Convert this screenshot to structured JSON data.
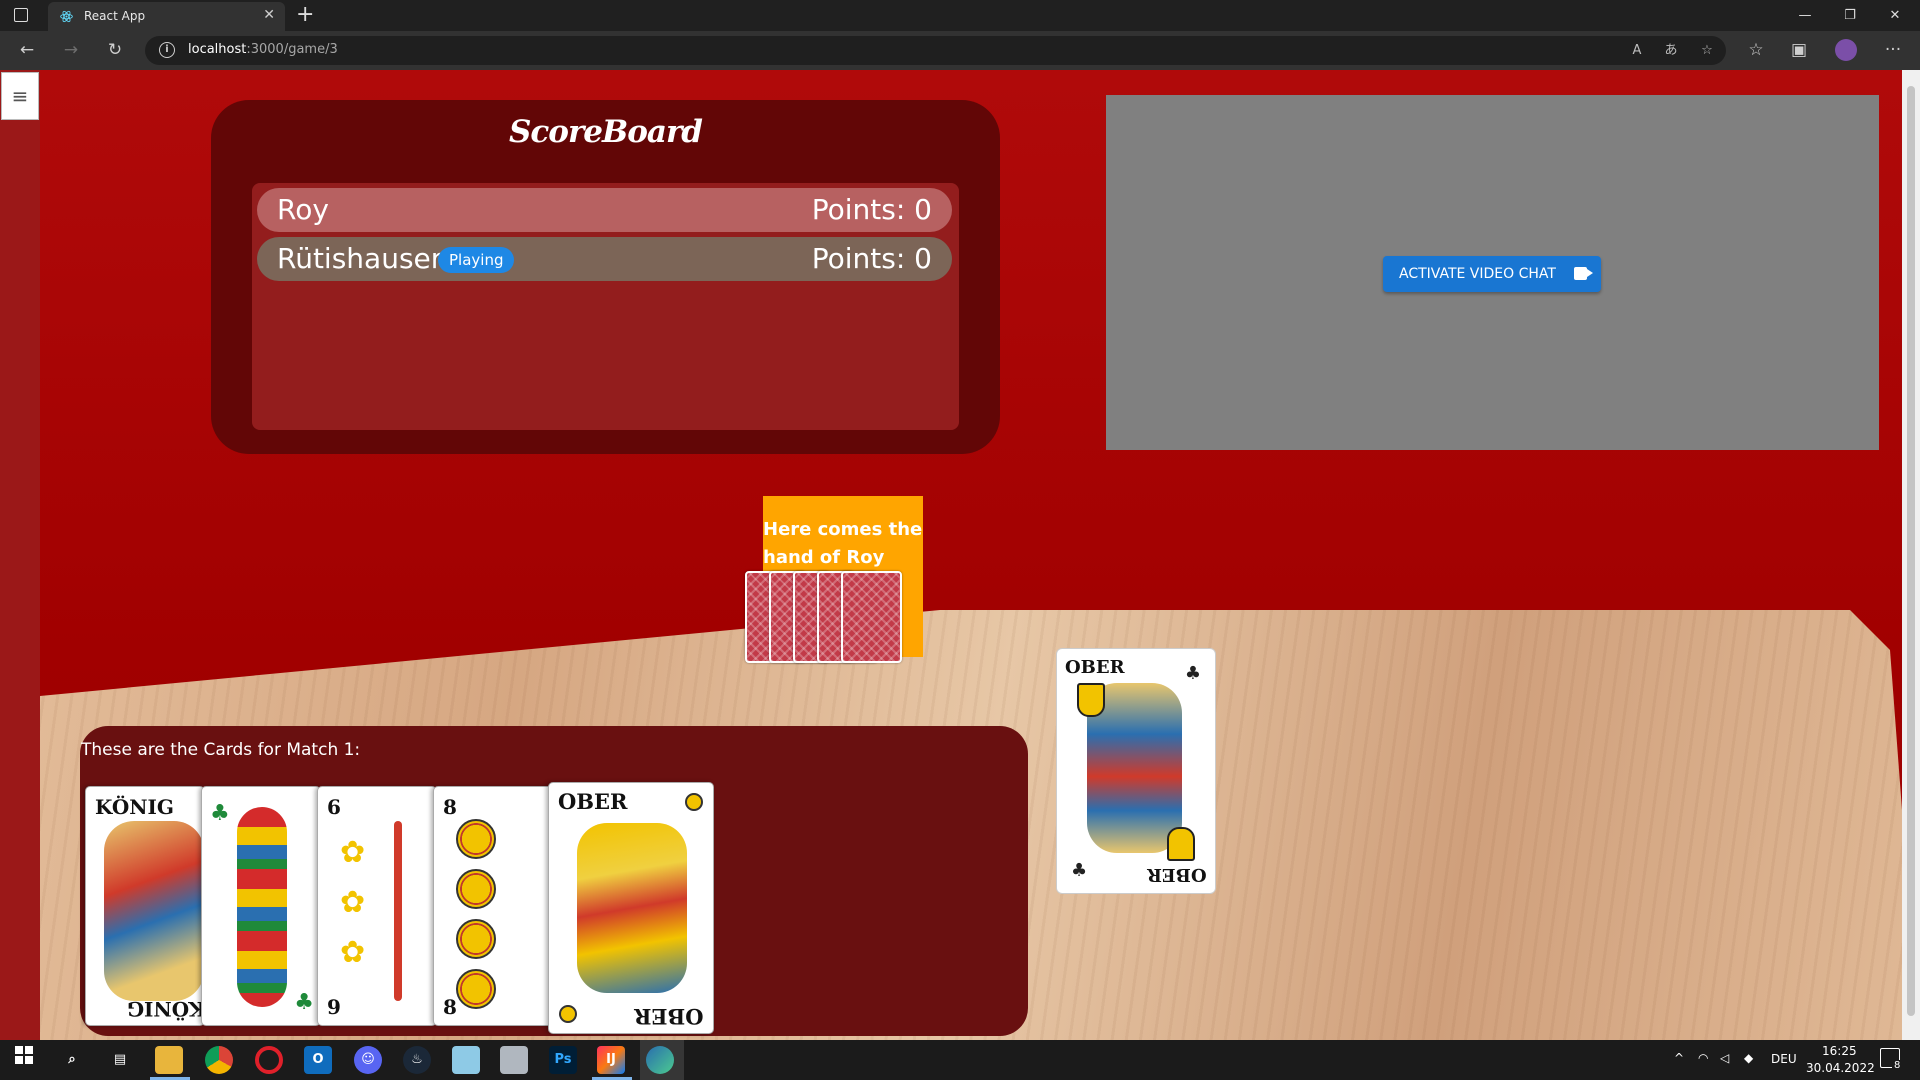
{
  "browser": {
    "tab_title": "React App",
    "tab_close": "✕",
    "new_tab": "+",
    "url_host": "localhost",
    "url_path": ":3000/game/3",
    "controls": {
      "minimize": "—",
      "restore": "❐",
      "close": "✕"
    },
    "toolbar_icons": {
      "back": "←",
      "forward": "→",
      "reload": "↻",
      "menu": "···"
    }
  },
  "app": {
    "menu_icon": "≡",
    "scoreboard": {
      "title": "ScoreBoard",
      "players": [
        {
          "name": "Roy",
          "points": "Points: 0",
          "row_color": "#b76161"
        },
        {
          "name": "Rütishauser",
          "badge": "Playing",
          "points": "Points: 0",
          "row_color": "#7c6557"
        }
      ]
    },
    "video_chat": {
      "button_label": "ACTIVATE VIDEO CHAT"
    },
    "opponent": {
      "label": "Here comes the hand of Roy",
      "card_count": 5
    },
    "played_card": {
      "name": "OBER",
      "name_rotated": "OBER"
    },
    "hand": {
      "label": "These are the Cards for Match 1:",
      "cards": [
        {
          "top": "KÖNIG",
          "bottom": "KÖNIG"
        },
        {
          "top": "",
          "bottom": ""
        },
        {
          "top": "6",
          "bottom": "9"
        },
        {
          "top": "8",
          "bottom": "8"
        },
        {
          "top": "OBER",
          "bottom": "OBER"
        }
      ]
    }
  },
  "taskbar": {
    "lang": "DEU",
    "time": "16:25",
    "date": "30.04.2022",
    "notifications": "8"
  },
  "colors": {
    "page_red": "#a10000",
    "scoreboard": "#620606",
    "accent_blue": "#1976d2",
    "opponent_box": "#ffa500"
  }
}
